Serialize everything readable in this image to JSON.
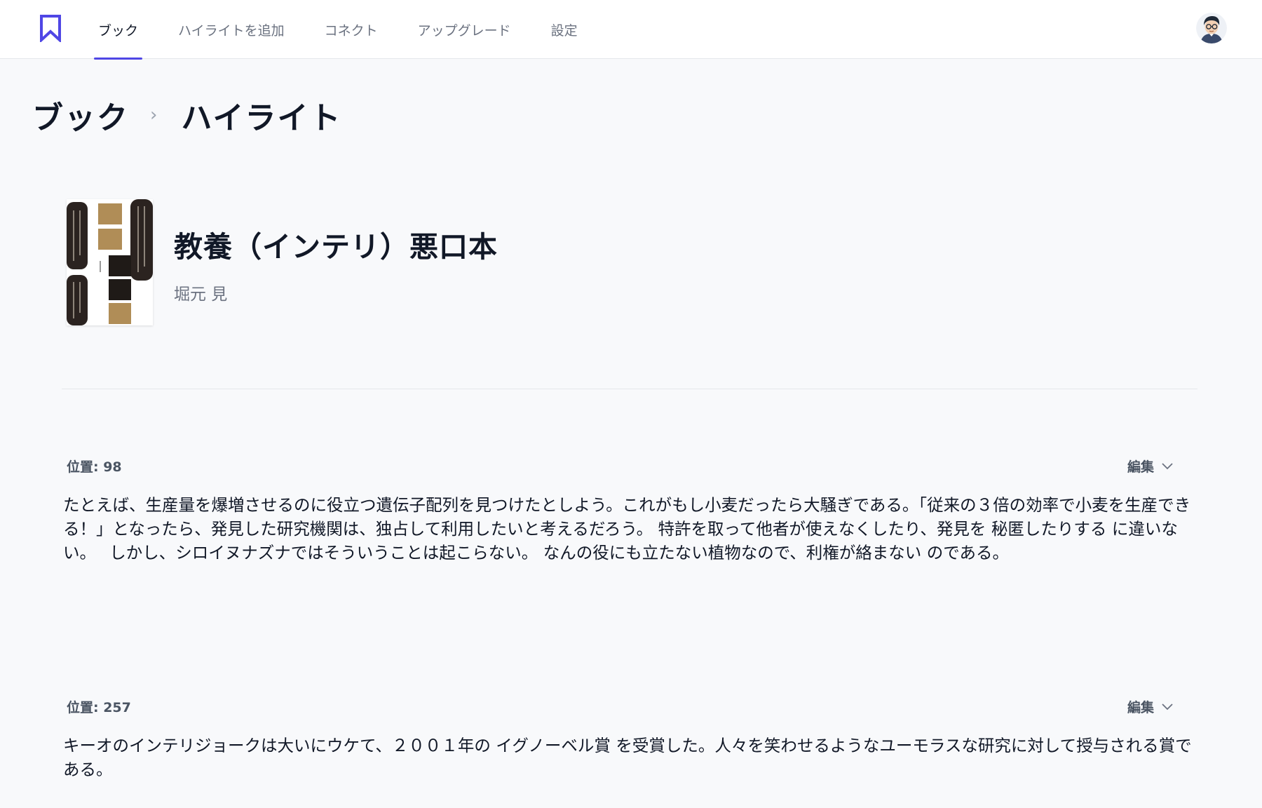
{
  "nav": {
    "tabs": [
      {
        "label": "ブック"
      },
      {
        "label": "ハイライトを追加"
      },
      {
        "label": "コネクト"
      },
      {
        "label": "アップグレード"
      },
      {
        "label": "設定"
      }
    ],
    "active_tab": "ブック",
    "accent_color": "#4f46e5"
  },
  "breadcrumb": {
    "parent": "ブック",
    "current": "ハイライト"
  },
  "book": {
    "title": "教養（インテリ）悪口本",
    "author": "堀元 見"
  },
  "highlights": [
    {
      "location": "位置: 98",
      "edit_label": "編集",
      "text": "たとえば、生産量を爆増させるのに役立つ遺伝子配列を見つけたとしよう。これがもし小麦だったら大騒ぎである。「従来の３倍の効率で小麦を生産できる！」となったら、発見した研究機関は、独占して利用したいと考えるだろう。 特許を取って他者が使えなくしたり、発見を 秘匿したりする に違いない。　 しかし、シロイヌナズナではそういうことは起こらない。 なんの役にも立たない植物なので、利権が絡まない のである。"
    },
    {
      "location": "位置: 257",
      "edit_label": "編集",
      "text": "キーオのインテリジョークは大いにウケて、２００１年の イグノーベル賞 を受賞した。人々を笑わせるようなユーモラスな研究に対して授与される賞である。"
    }
  ]
}
